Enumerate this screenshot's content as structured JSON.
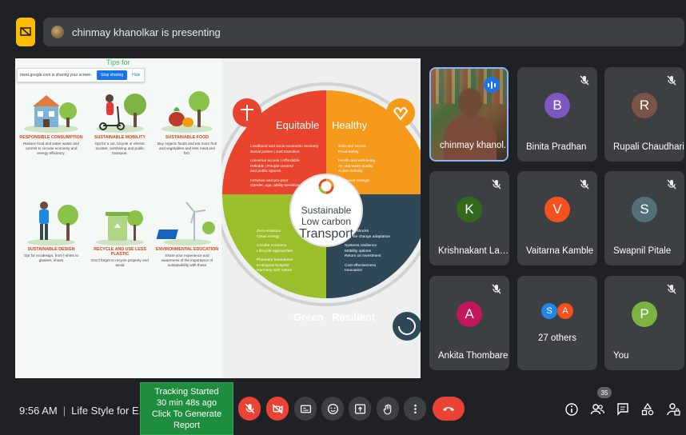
{
  "banner": {
    "presenter_text": "chinmay khanolkar is presenting"
  },
  "share_bar": {
    "text": "meet.google.com is sharing your screen.",
    "stop_label": "Stop sharing",
    "hide_label": "Hide"
  },
  "slide_left": {
    "title": "Tips for",
    "tips": [
      {
        "title": "RESPONSIBLE CONSUMPTION",
        "text": "Reduce food and water waste and commit to circular economy and energy efficiency."
      },
      {
        "title": "SUSTAINABLE MOBILITY",
        "text": "Opt for a car, bicycle or electric scooter, carsharing and public transport."
      },
      {
        "title": "SUSTAINABLE FOOD",
        "text": "Buy organic foods and eat more fruit and vegetables and less meat and fish."
      },
      {
        "title": "SUSTAINABLE DESIGN",
        "text": "Opt for ecodesign, from t-shirts to glasses, shoes"
      },
      {
        "title": "RECYCLE AND USE LESS PLASTIC",
        "text": "Don't forget to recycle property and avoid"
      },
      {
        "title": "ENVIRONMENTAL EDUCATION",
        "text": "Share your experience and awareness of the importance of sustainability with those"
      }
    ]
  },
  "wheel": {
    "center_line1": "Sustainable",
    "center_line2": "Low carbon",
    "center_line3": "Transport",
    "quadrants": {
      "equitable": {
        "label": "Equitable",
        "lines": [
          "Livelihood and socio-economic recovery",
          "Social justice | Just transition",
          "Universal access | Affordable",
          "Reliable | People-centred",
          "and public spaces",
          "Inclusive and pro-poor",
          "Gender, age, ability-sensitive"
        ]
      },
      "healthy": {
        "label": "Healthy",
        "lines": [
          "Safe and secure",
          "Road safety",
          "Health and well-being",
          "Air and water quality",
          "Active mobility",
          "Behaviour change"
        ]
      },
      "green": {
        "label": "Green",
        "lines": [
          "Zero emission",
          "Clean energy",
          "Circular economy",
          "Lifecycle approaches",
          "Planetary boundaries",
          "Ecological footprint",
          "Harmony with nature"
        ]
      },
      "resilient": {
        "label": "Resilient",
        "lines": [
          "Global shocks",
          "Climate change adaptation",
          "Systems resilience",
          "Mobility options",
          "Return on investment",
          "Cost effectiveness",
          "Innovation"
        ]
      }
    }
  },
  "participants": [
    {
      "name": "chinmay khanol...",
      "initial": "",
      "color": ""
    },
    {
      "name": "Binita Pradhan",
      "initial": "B",
      "color": "#7e57c2"
    },
    {
      "name": "Rupali Chaudhari",
      "initial": "R",
      "color": "#795548"
    },
    {
      "name": "Krishnakant Las...",
      "initial": "K",
      "color": "#33691e"
    },
    {
      "name": "Vaitarna Kamble",
      "initial": "V",
      "color": "#f4511e"
    },
    {
      "name": "Swapnil Pitale",
      "initial": "S",
      "color": "#546e7a"
    },
    {
      "name": "Ankita Thombare",
      "initial": "A",
      "color": "#c2185b"
    },
    {
      "name": "You",
      "initial": "P",
      "color": "#7cb342"
    }
  ],
  "others": {
    "text": "27 others",
    "initial1": "S",
    "initial2": "A",
    "color1": "#1e88e5",
    "color2": "#f4511e"
  },
  "bottom": {
    "time": "9:56 AM",
    "meeting_title": "Life Style for E...",
    "tracking_line1": "Tracking Started",
    "tracking_line2": "30 min 48s ago",
    "tracking_line3": "Click To Generate Report",
    "people_count": "35"
  },
  "colors": {
    "equitable": "#e8442e",
    "healthy": "#f59a1b",
    "green": "#9bbf2b",
    "resilient": "#2f4858",
    "tracking_green": "#1e8e3e",
    "end_call_red": "#ea4335"
  }
}
